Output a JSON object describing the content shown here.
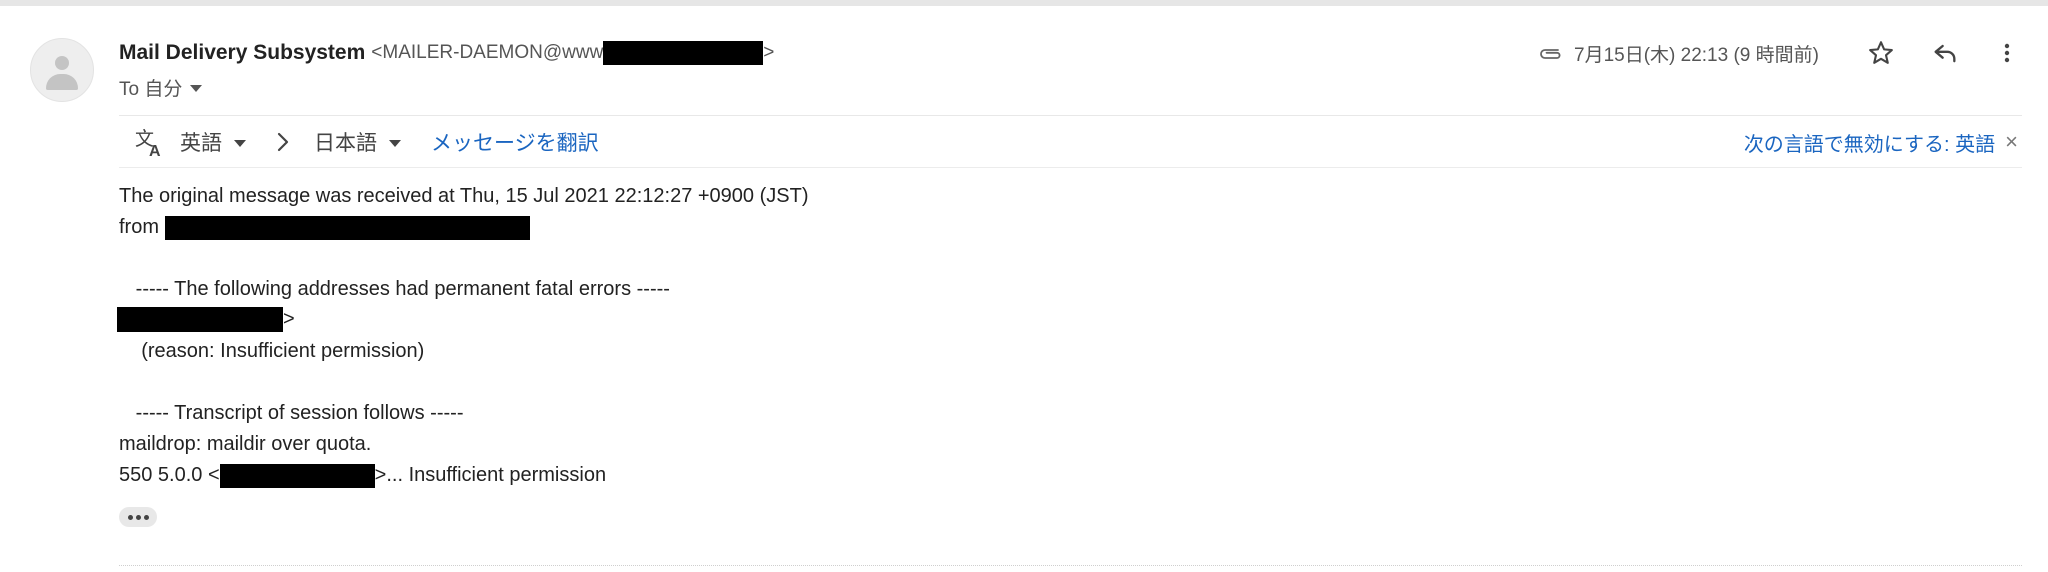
{
  "message": {
    "sender_name": "Mail Delivery Subsystem",
    "sender_email_prefix": "<MAILER-DAEMON@www",
    "sender_email_suffix": ">",
    "to_label": "To 自分",
    "date": "7月15日(木) 22:13 (9 時間前)"
  },
  "translate": {
    "source_lang": "英語",
    "target_lang": "日本語",
    "translate_link": "メッセージを翻訳",
    "disable_text": "次の言語で無効にする: 英語",
    "close_symbol": "×"
  },
  "body": {
    "line1": "The original message was received at Thu, 15 Jul 2021 22:12:27 +0900 (JST)",
    "line2": "from",
    "line3": "   ----- The following addresses had permanent fatal errors -----",
    "line4_suffix": ">",
    "line5": "    (reason: Insufficient permission)",
    "line6": "   ----- Transcript of session follows -----",
    "line7": "maildrop: maildir over quota.",
    "line8_prefix": "550 5.0.0 <",
    "line8_suffix": ">... Insufficient permission"
  },
  "icons": {
    "attachment": "paperclip-icon",
    "star": "star-icon",
    "reply": "reply-icon",
    "more": "more-vert-icon",
    "translate": "translate-icon",
    "chevron": "chevron-right-icon",
    "collapse": "show-trimmed-content-icon"
  },
  "colors": {
    "link": "#1a65c0",
    "redaction": "#000000"
  }
}
